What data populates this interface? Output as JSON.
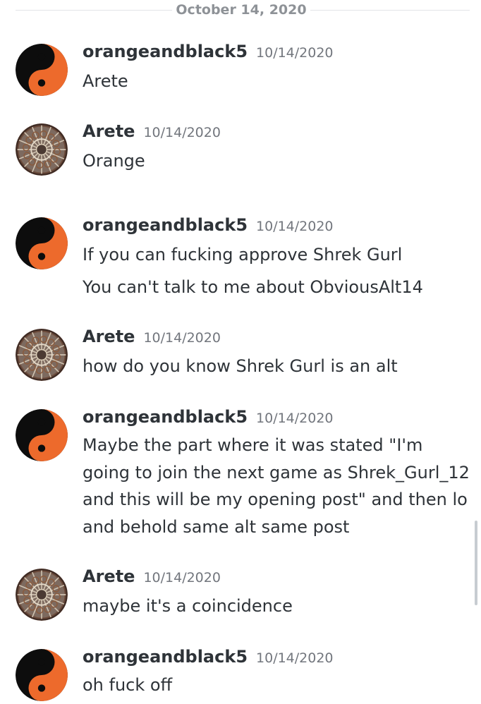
{
  "date_divider": "October 14, 2020",
  "messages": [
    {
      "username": "orangeandblack5",
      "timestamp": "10/14/2020",
      "avatar": "yin-yang-icon",
      "lines": [
        "Arete"
      ]
    },
    {
      "username": "Arete",
      "timestamp": "10/14/2020",
      "avatar": "mandala-avatar",
      "lines": [
        "Orange"
      ]
    },
    {
      "username": "orangeandblack5",
      "timestamp": "10/14/2020",
      "avatar": "yin-yang-icon",
      "lines": [
        "If you can fucking approve Shrek Gurl",
        "You can't talk to me about ObviousAlt14"
      ]
    },
    {
      "username": "Arete",
      "timestamp": "10/14/2020",
      "avatar": "mandala-avatar",
      "lines": [
        "how do you know Shrek Gurl is an alt"
      ]
    },
    {
      "username": "orangeandblack5",
      "timestamp": "10/14/2020",
      "avatar": "yin-yang-icon",
      "lines": [
        "Maybe the part where it was stated \"I'm",
        "going to join the next game as Shrek_Gurl_12",
        "and this will be my opening post\" and then lo",
        "and behold same alt same post"
      ]
    },
    {
      "username": "Arete",
      "timestamp": "10/14/2020",
      "avatar": "mandala-avatar",
      "lines": [
        "maybe it's a coincidence"
      ]
    },
    {
      "username": "orangeandblack5",
      "timestamp": "10/14/2020",
      "avatar": "yin-yang-icon",
      "lines": [
        "oh fuck off"
      ]
    }
  ],
  "colors": {
    "orange": "#ed6a2c",
    "black": "#0d0d0d",
    "username": "#2e3338",
    "timestamp": "#72767d",
    "divider_text": "#8e9297"
  }
}
